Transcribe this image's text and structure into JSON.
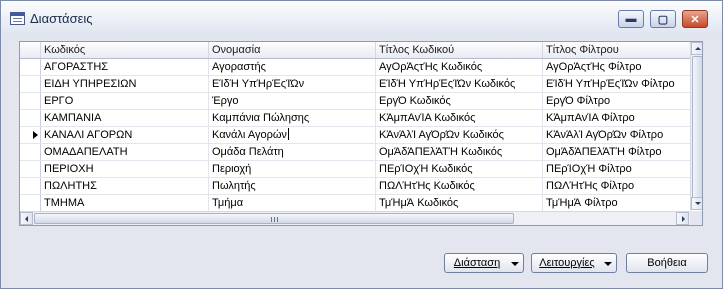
{
  "window": {
    "title": "Διαστάσεις"
  },
  "grid": {
    "columns": [
      "Κωδικός",
      "Ονομασία",
      "Τίτλος Κωδικού",
      "Τίτλος Φίλτρου"
    ],
    "rows": [
      [
        "ΑΓΟΡΑΣΤΗΣ",
        "Αγοραστής",
        "ΑγΟρΆςτΉς Κωδικός",
        "ΑγΟρΆςτΉς Φίλτρο"
      ],
      [
        "ΕΙΔΗ ΥΠΗΡΕΣΙΩΝ",
        "ΕΊδΉ ΥπΉρΈςΊΏν",
        "ΕΊδΉ ΥπΉρΈςΊΏν Κωδικός",
        "ΕΊδΉ ΥπΉρΈςΊΏν Φίλτρο"
      ],
      [
        "ΕΡΓΟ",
        "Έργο",
        "ΕργΌ Κωδικός",
        "ΕργΌ Φίλτρο"
      ],
      [
        "ΚΑΜΠΑΝΙΑ",
        "Καμπάνια Πώλησης",
        "ΚΆμπΑνΊΑ Κωδικός",
        "ΚΆμπΑνΊΑ Φίλτρο"
      ],
      [
        "ΚΑΝΑΛΙ ΑΓΟΡΩΝ",
        "Κανάλι Αγορών",
        "ΚΆνΆλΊ ΑγΌρΏν Κωδικός",
        "ΚΆνΆλΊ ΑγΌρΏν Φίλτρο"
      ],
      [
        "ΟΜΑΔΑΠΕΛΑΤΗ",
        "Ομάδα Πελάτη",
        "ΟμΆδΆΠΕλΆΤΉ Κωδικός",
        "ΟμΆδΆΠΕλΆΤΉ Φίλτρο"
      ],
      [
        "ΠΕΡΙΟΧΗ",
        "Περιοχή",
        "ΠΕρΊΟχΉ Κωδικός",
        "ΠΕρΊΟχΉ Φίλτρο"
      ],
      [
        "ΠΩΛΗΤΗΣ",
        "Πωλητής",
        "ΠΩΛΉτΉς Κωδικός",
        "ΠΩΛΉτΉς Φίλτρο"
      ],
      [
        "ΤΜΗΜΑ",
        "Τμήμα",
        "ΤμΉμΆ Κωδικός",
        "ΤμΉμΆ Φίλτρο"
      ]
    ],
    "current_row_index": 4
  },
  "buttons": {
    "dimension": "Διάσταση",
    "functions": "Λειτουργίες",
    "help": "Βοήθεια"
  },
  "icons": {
    "app": "table-icon",
    "minimize": "minimize-icon",
    "maximize": "maximize-icon",
    "close": "close-icon"
  }
}
